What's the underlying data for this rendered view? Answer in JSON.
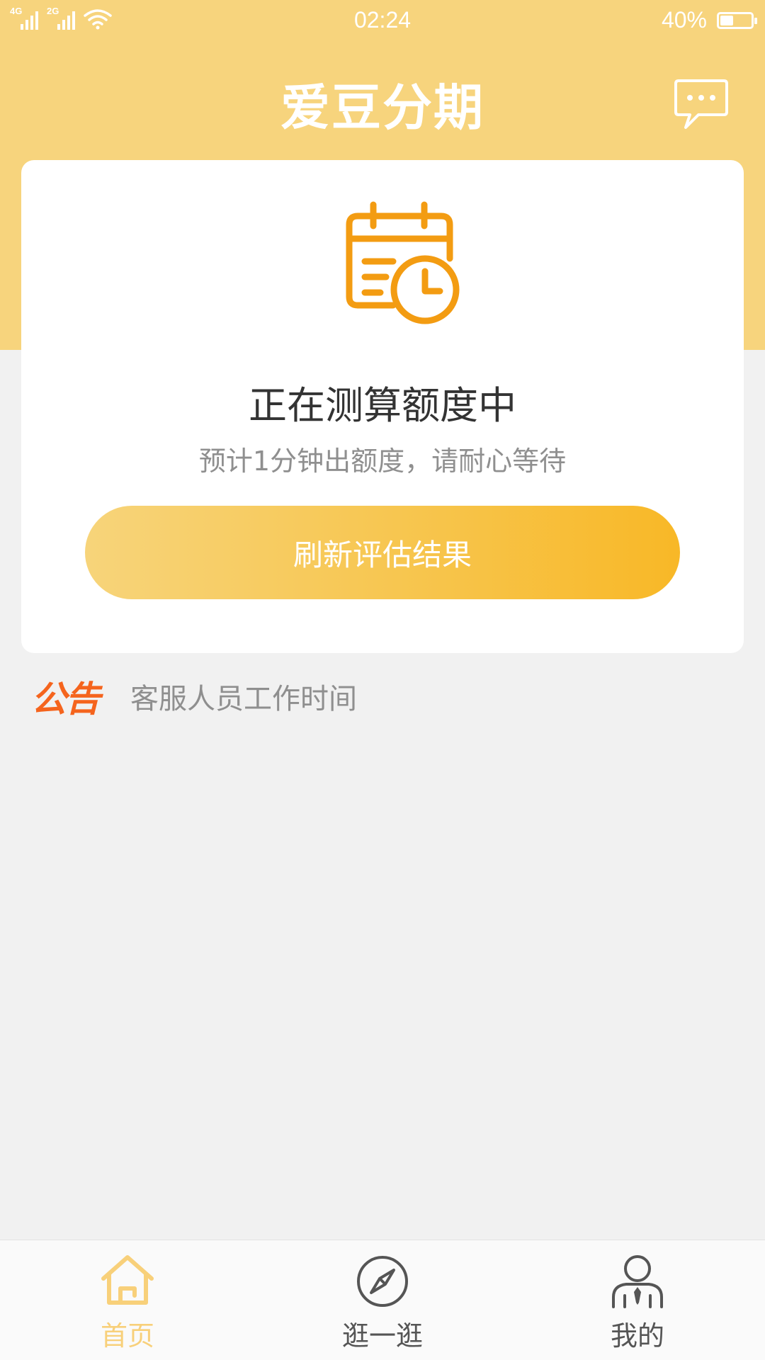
{
  "status_bar": {
    "network_1": "4G",
    "network_2": "2G",
    "time": "02:24",
    "battery": "40%",
    "battery_level": 0.4,
    "wifi_icon": "wifi-icon"
  },
  "header": {
    "title": "爱豆分期",
    "message_icon": "chat-bubble-icon"
  },
  "card": {
    "icon": "calendar-clock-icon",
    "title": "正在测算额度中",
    "subtitle": "预计1分钟出额度，请耐心等待",
    "button_label": "刷新评估结果"
  },
  "notice": {
    "tag": "公告",
    "text": "客服人员工作时间"
  },
  "tabs": [
    {
      "label": "首页",
      "icon": "home-icon",
      "active": true
    },
    {
      "label": "逛一逛",
      "icon": "compass-icon",
      "active": false
    },
    {
      "label": "我的",
      "icon": "user-icon",
      "active": false
    }
  ],
  "colors": {
    "brand": "#f7d47d",
    "accent_orange": "#f5641d",
    "icon_orange": "#f39c12",
    "button_gradient_start": "#f7d47a",
    "button_gradient_end": "#f8b827",
    "tab_active": "#f8d07a",
    "tab_inactive": "#555555"
  }
}
